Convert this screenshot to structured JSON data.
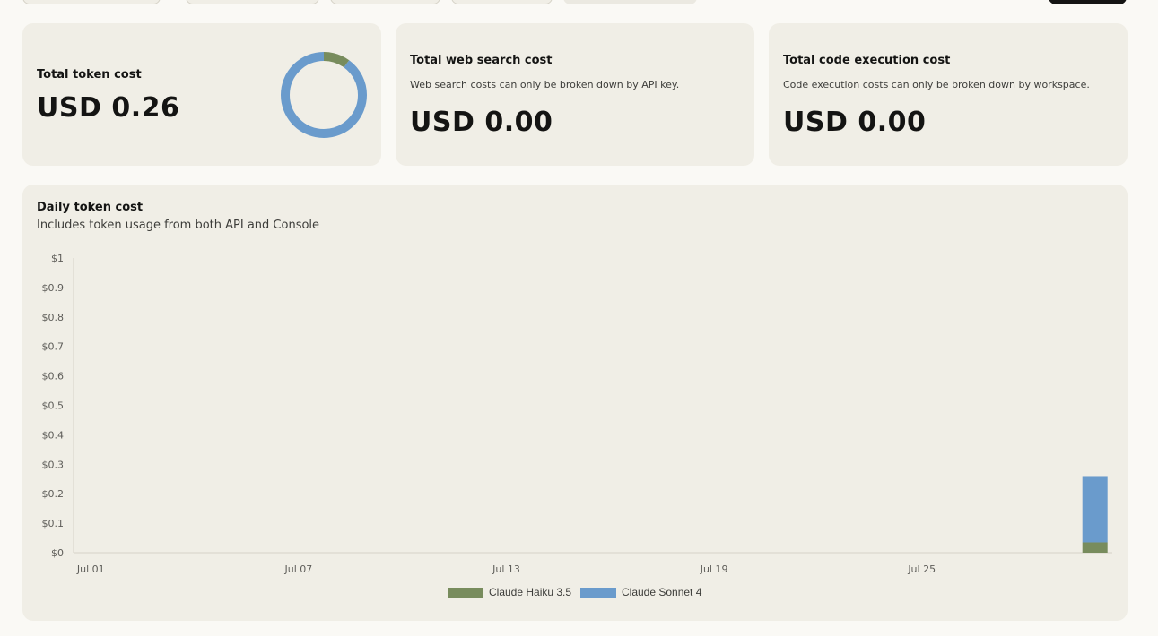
{
  "cards": {
    "token_cost": {
      "title": "Total token cost",
      "value": "USD 0.26",
      "donut": [
        {
          "name": "Claude Haiku 3.5",
          "fraction": 0.1,
          "color": "#788c5d"
        },
        {
          "name": "Claude Sonnet 4",
          "fraction": 0.9,
          "color": "#6a9bcc"
        }
      ]
    },
    "web_search": {
      "title": "Total web search cost",
      "note": "Web search costs can only be broken down by API key.",
      "value": "USD 0.00"
    },
    "code_execution": {
      "title": "Total code execution cost",
      "note": "Code execution costs can only be broken down by workspace.",
      "value": "USD 0.00"
    }
  },
  "daily_chart": {
    "title": "Daily token cost",
    "subtitle": "Includes token usage from both API and Console"
  },
  "chart_data": {
    "type": "bar",
    "stacked": true,
    "title": "Daily token cost",
    "ylim": [
      0,
      1
    ],
    "y_ticks": [
      "$0",
      "$0.1",
      "$0.2",
      "$0.3",
      "$0.4",
      "$0.5",
      "$0.6",
      "$0.7",
      "$0.8",
      "$0.9",
      "$1"
    ],
    "x_ticks": [
      "Jul 01",
      "Jul 07",
      "Jul 13",
      "Jul 19",
      "Jul 25"
    ],
    "categories": [
      "Jul 01",
      "Jul 02",
      "Jul 03",
      "Jul 04",
      "Jul 05",
      "Jul 06",
      "Jul 07",
      "Jul 08",
      "Jul 09",
      "Jul 10",
      "Jul 11",
      "Jul 12",
      "Jul 13",
      "Jul 14",
      "Jul 15",
      "Jul 16",
      "Jul 17",
      "Jul 18",
      "Jul 19",
      "Jul 20",
      "Jul 21",
      "Jul 22",
      "Jul 23",
      "Jul 24",
      "Jul 25",
      "Jul 26",
      "Jul 27",
      "Jul 28",
      "Jul 29",
      "Jul 30"
    ],
    "series": [
      {
        "name": "Claude Haiku 3.5",
        "color": "#788c5d",
        "values": [
          0,
          0,
          0,
          0,
          0,
          0,
          0,
          0,
          0,
          0,
          0,
          0,
          0,
          0,
          0,
          0,
          0,
          0,
          0,
          0,
          0,
          0,
          0,
          0,
          0,
          0,
          0,
          0,
          0,
          0.035
        ]
      },
      {
        "name": "Claude Sonnet 4",
        "color": "#6a9bcc",
        "values": [
          0,
          0,
          0,
          0,
          0,
          0,
          0,
          0,
          0,
          0,
          0,
          0,
          0,
          0,
          0,
          0,
          0,
          0,
          0,
          0,
          0,
          0,
          0,
          0,
          0,
          0,
          0,
          0,
          0,
          0.225
        ]
      }
    ],
    "grid": false,
    "legend": "bottom-center"
  }
}
